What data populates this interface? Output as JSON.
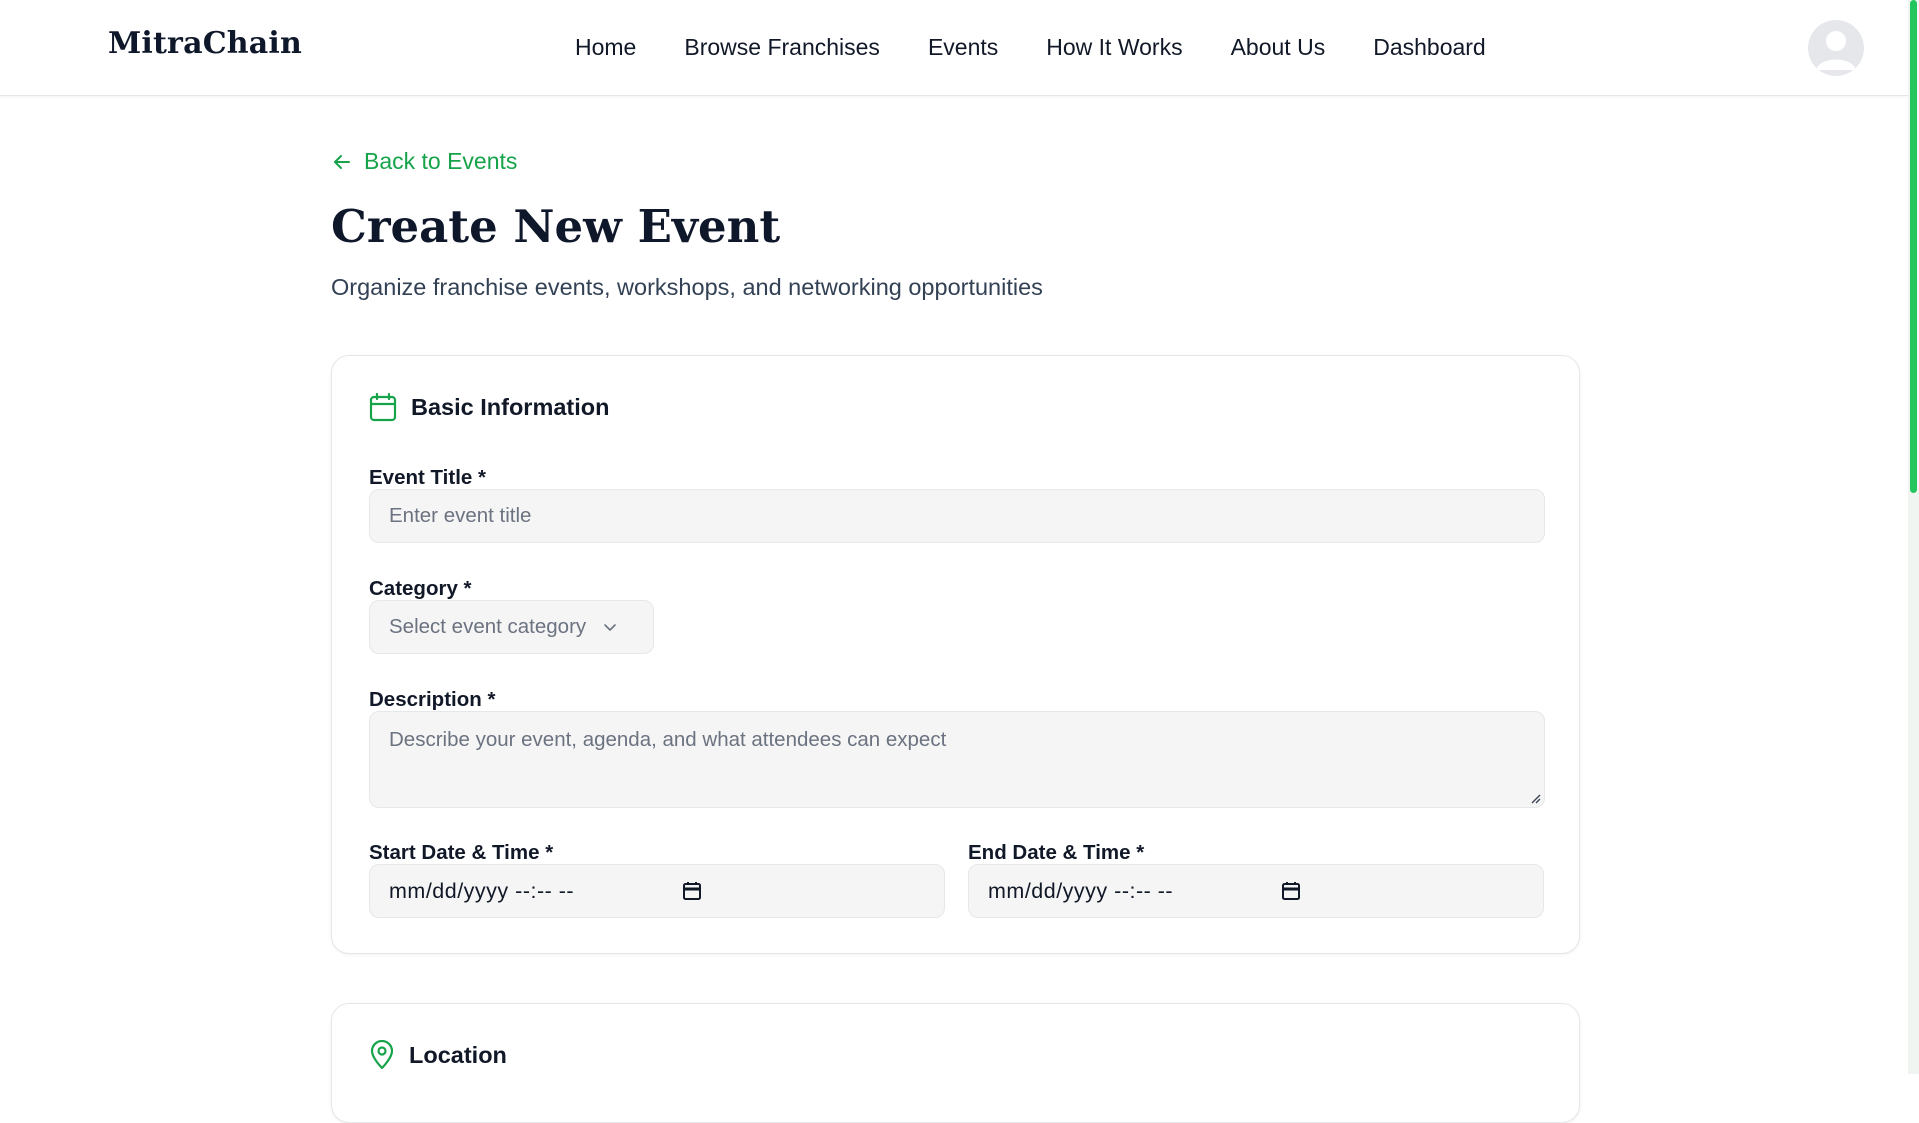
{
  "header": {
    "logo": "MitraChain",
    "nav": [
      "Home",
      "Browse Franchises",
      "Events",
      "How It Works",
      "About Us",
      "Dashboard"
    ]
  },
  "colors": {
    "accent": "#16a34a",
    "scrollbar_thumb": "#22c55e",
    "field_bg": "#f5f5f5"
  },
  "back_link": "Back to Events",
  "page": {
    "title": "Create New Event",
    "subtitle": "Organize franchise events, workshops, and networking opportunities"
  },
  "basic_info": {
    "title": "Basic Information",
    "icon": "calendar-icon",
    "event_title_label": "Event Title *",
    "event_title_placeholder": "Enter event title",
    "category_label": "Category *",
    "category_value": "Select event category",
    "description_label": "Description *",
    "description_placeholder": "Describe your event, agenda, and what attendees can expect",
    "start_label": "Start Date & Time *",
    "start_value": "mm/dd/yyyy --:-- --",
    "end_label": "End Date & Time *",
    "end_value": "mm/dd/yyyy --:-- --"
  },
  "location": {
    "title": "Location",
    "icon": "map-pin-icon"
  }
}
